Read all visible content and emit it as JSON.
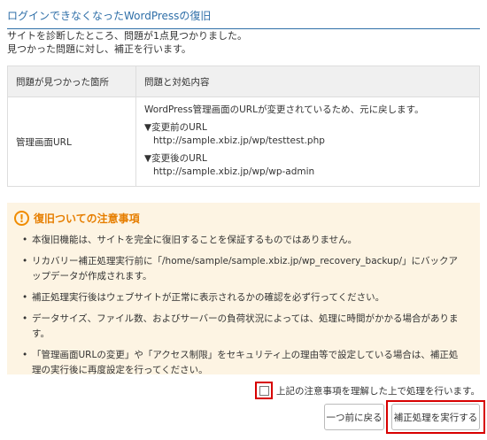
{
  "header": {
    "title": "ログインできなくなったWordPressの復旧"
  },
  "intro": {
    "line1": "サイトを診断したところ、問題が1点見つかりました。",
    "line2": "見つかった問題に対し、補正を行います。"
  },
  "table": {
    "col_location": "問題が見つかった箇所",
    "col_issue": "問題と対処内容",
    "row": {
      "location": "管理画面URL",
      "description": "WordPress管理画面のURLが変更されているため、元に戻します。",
      "before_label": "▼変更前のURL",
      "before_url": "http://sample.xbiz.jp/wp/testtest.php",
      "after_label": "▼変更後のURL",
      "after_url": "http://sample.xbiz.jp/wp/wp-admin"
    }
  },
  "notes": {
    "icon": "exclamation-circle-icon",
    "title": "復旧ついての注意事項",
    "items": [
      "本復旧機能は、サイトを完全に復旧することを保証するものではありません。",
      "リカバリー補正処理実行前に「/home/sample/sample.xbiz.jp/wp_recovery_backup/」にバックアップデータが作成されます。",
      "補正処理実行後はウェブサイトが正常に表示されるかの確認を必ず行ってください。",
      "データサイズ、ファイル数、およびサーバーの負荷状況によっては、処理に時間がかかる場合があります。",
      "「管理画面URLの変更」や「アクセス制限」をセキュリティ上の理由等で設定している場合は、補正処理の実行後に再度設定を行ってください。"
    ]
  },
  "confirm": {
    "label": "上記の注意事項を理解した上で処理を行います。",
    "checked": false
  },
  "buttons": {
    "back": "一つ前に戻る",
    "execute": "補正処理を実行する"
  },
  "colors": {
    "accent": "#2f6fa8",
    "warning": "#f08c00",
    "highlight": "#d70000",
    "notes_bg": "#fdf4e3"
  }
}
